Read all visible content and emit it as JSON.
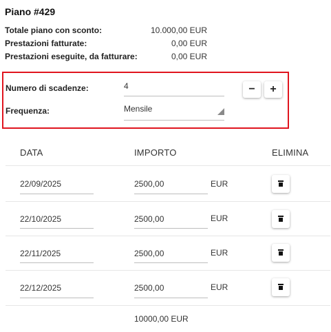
{
  "plan": {
    "title": "Piano #429",
    "summary": [
      {
        "label": "Totale piano con sconto:",
        "value": "10.000,00 EUR"
      },
      {
        "label": "Prestazioni fatturate:",
        "value": "0,00 EUR"
      },
      {
        "label": "Prestazioni eseguite, da fatturare:",
        "value": "0,00 EUR"
      }
    ]
  },
  "form": {
    "installments_label": "Numero di scadenze:",
    "installments_value": "4",
    "minus_label": "−",
    "plus_label": "+",
    "frequency_label": "Frequenza:",
    "frequency_value": "Mensile"
  },
  "table": {
    "headers": {
      "date": "DATA",
      "amount": "IMPORTO",
      "delete": "ELIMINA"
    },
    "rows": [
      {
        "date": "22/09/2025",
        "amount": "2500,00",
        "currency": "EUR"
      },
      {
        "date": "22/10/2025",
        "amount": "2500,00",
        "currency": "EUR"
      },
      {
        "date": "22/11/2025",
        "amount": "2500,00",
        "currency": "EUR"
      },
      {
        "date": "22/12/2025",
        "amount": "2500,00",
        "currency": "EUR"
      }
    ],
    "total": "10000,00 EUR"
  },
  "colors": {
    "highlight_border": "#e0141e"
  },
  "icons": {
    "delete": "trash-icon",
    "dropdown": "dropdown-arrow-icon"
  }
}
